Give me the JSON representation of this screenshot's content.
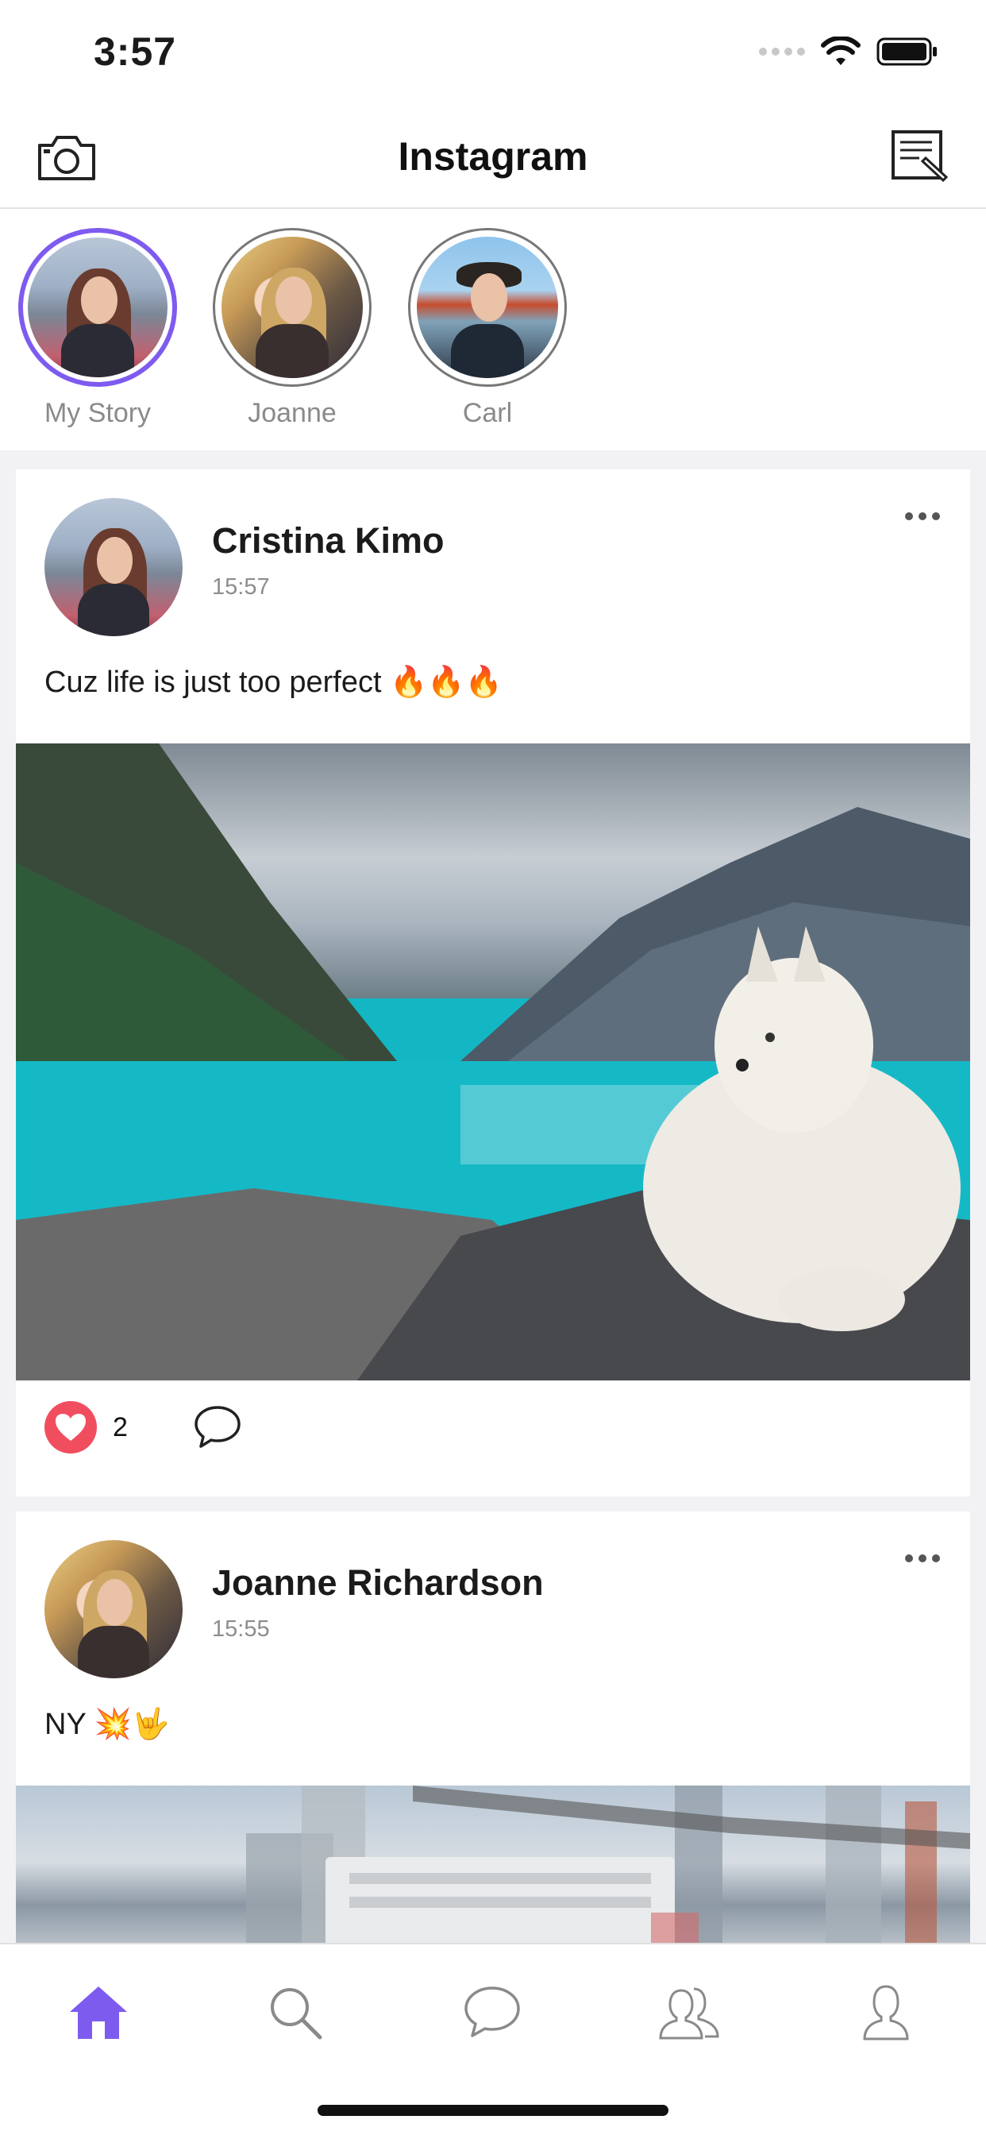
{
  "status_bar": {
    "time": "3:57"
  },
  "navbar": {
    "title": "Instagram"
  },
  "stories": [
    {
      "label": "My Story",
      "active": true
    },
    {
      "label": "Joanne",
      "active": false
    },
    {
      "label": "Carl",
      "active": false
    }
  ],
  "posts": [
    {
      "author": "Cristina Kimo",
      "time": "15:57",
      "text": "Cuz life is just too perfect 🔥🔥🔥",
      "likes": "2"
    },
    {
      "author": "Joanne Richardson",
      "time": "15:55",
      "text": "NY 💥🤟"
    }
  ],
  "colors": {
    "accent": "#7e5bef",
    "like": "#f04e5f",
    "tab_active": "#7e5bef",
    "tab_inactive": "#8a8a8a"
  },
  "tabs": [
    {
      "icon": "home-icon",
      "active": true
    },
    {
      "icon": "search-icon",
      "active": false
    },
    {
      "icon": "chat-icon",
      "active": false
    },
    {
      "icon": "friends-icon",
      "active": false
    },
    {
      "icon": "profile-icon",
      "active": false
    }
  ]
}
